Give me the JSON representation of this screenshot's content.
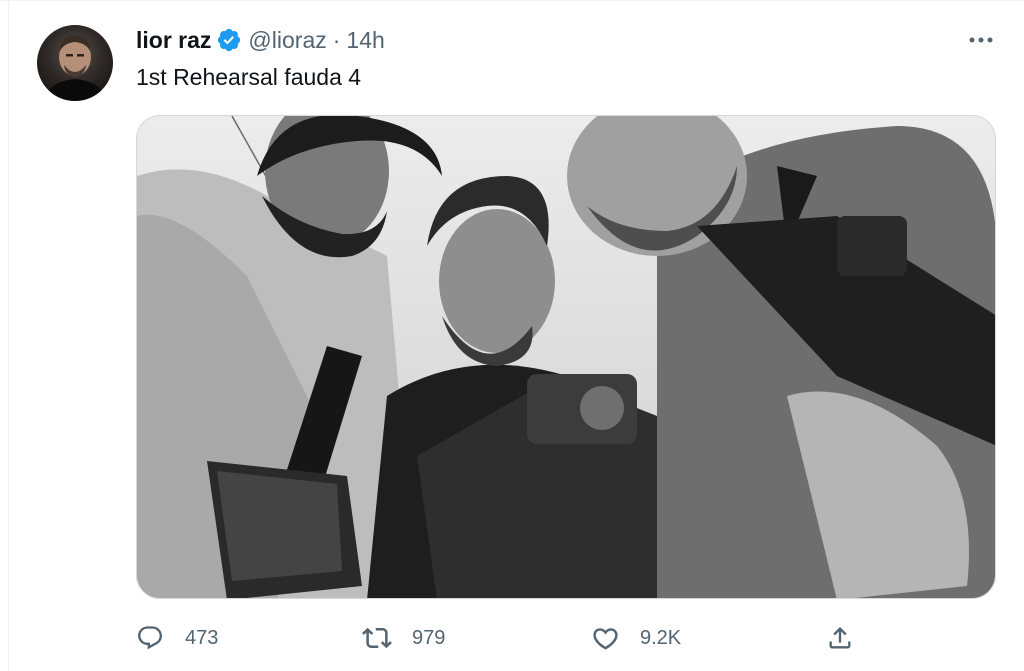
{
  "tweet": {
    "display_name": "lior raz",
    "handle": "@lioraz",
    "separator": "·",
    "time": "14h",
    "text": "1st Rehearsal fauda 4",
    "verified": true
  },
  "actions": {
    "reply_count": "473",
    "retweet_count": "979",
    "like_count": "9.2K"
  },
  "icons": {
    "verified": "verified-badge-icon",
    "more": "more-dots-icon",
    "reply": "reply-icon",
    "retweet": "retweet-icon",
    "like": "heart-icon",
    "share": "share-icon"
  },
  "colors": {
    "verified_blue": "#1d9bf0",
    "secondary_text": "#536471",
    "primary_text": "#0f1419"
  }
}
